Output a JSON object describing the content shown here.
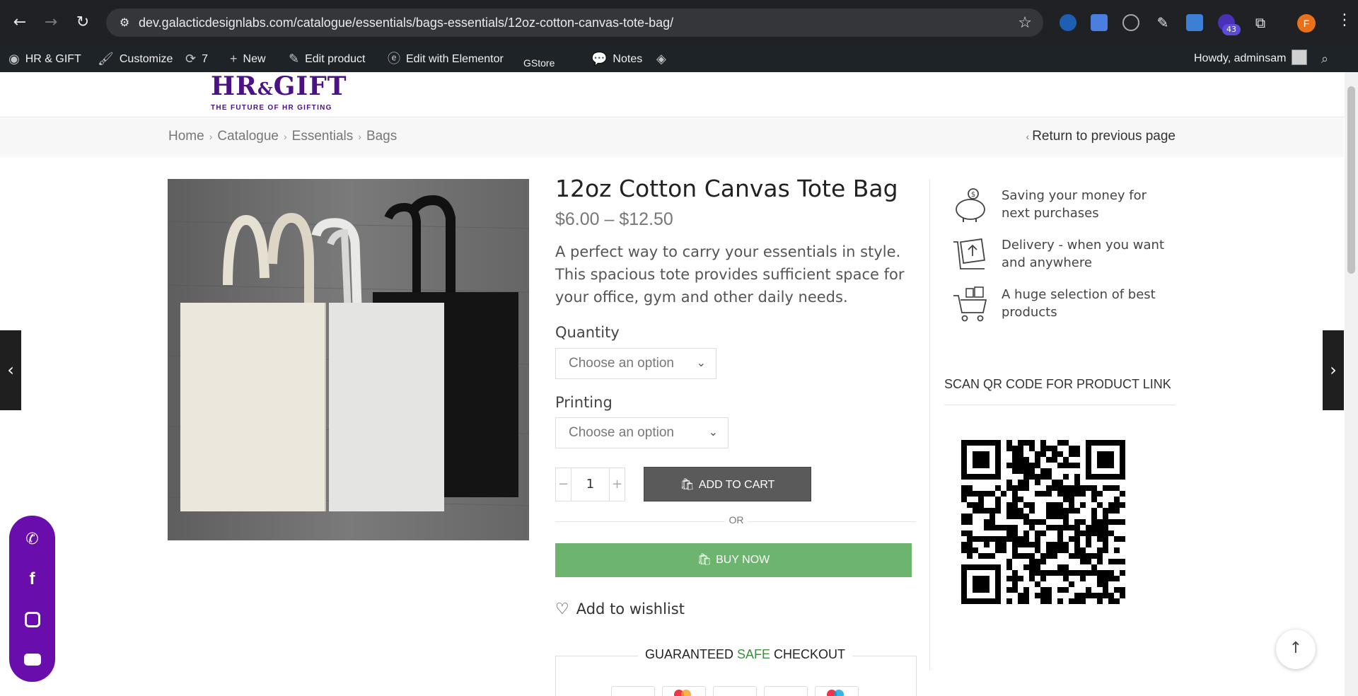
{
  "browser": {
    "url": "dev.galacticdesignlabs.com/catalogue/essentials/bags-essentials/12oz-cotton-canvas-tote-bag/",
    "extension_badge": "43",
    "profile_initial": "F"
  },
  "adminbar": {
    "site_name": "HR & GIFT",
    "customize": "Customize",
    "updates_count": "7",
    "new": "New",
    "edit_product": "Edit product",
    "edit_elementor": "Edit with Elementor",
    "gstore": "GStore",
    "notes": "Notes",
    "howdy": "Howdy, adminsam"
  },
  "header": {
    "logo_main_1": "HR",
    "logo_amp": "&",
    "logo_main_2": "GIFT",
    "logo_tagline": "THE FUTURE OF HR GIFTING",
    "brand_color": "#4b1185"
  },
  "breadcrumb": {
    "items": [
      "Home",
      "Catalogue",
      "Essentials",
      "Bags"
    ],
    "return": "Return to previous page"
  },
  "product": {
    "title": "12oz Cotton Canvas Tote Bag",
    "price": "$6.00 – $12.50",
    "description": "A perfect way to carry your essentials in style. This spacious tote provides sufficient space for your office, gym and other daily needs.",
    "quantity_label": "Quantity",
    "quantity_select": "Choose an option",
    "printing_label": "Printing",
    "printing_select": "Choose an option",
    "qty_value": "1",
    "add_to_cart": "ADD TO CART",
    "or": "OR",
    "buy_now": "BUY NOW",
    "wishlist": "Add to wishlist",
    "checkout_pre": "GUARANTEED ",
    "checkout_safe": "SAFE",
    "checkout_post": " CHECKOUT"
  },
  "sidebar": {
    "features": [
      {
        "text": "Saving your money for next purchases",
        "icon": "piggy-bank-icon"
      },
      {
        "text": "Delivery - when you want and anywhere",
        "icon": "delivery-box-icon"
      },
      {
        "text": "A huge selection of best products",
        "icon": "cart-gifts-icon"
      }
    ],
    "qr_title": "SCAN QR CODE FOR PRODUCT LINK"
  },
  "colors": {
    "buy_now": "#6db56e",
    "add_to_cart": "#5a5a5a",
    "social_bar": "#6a0dad"
  }
}
